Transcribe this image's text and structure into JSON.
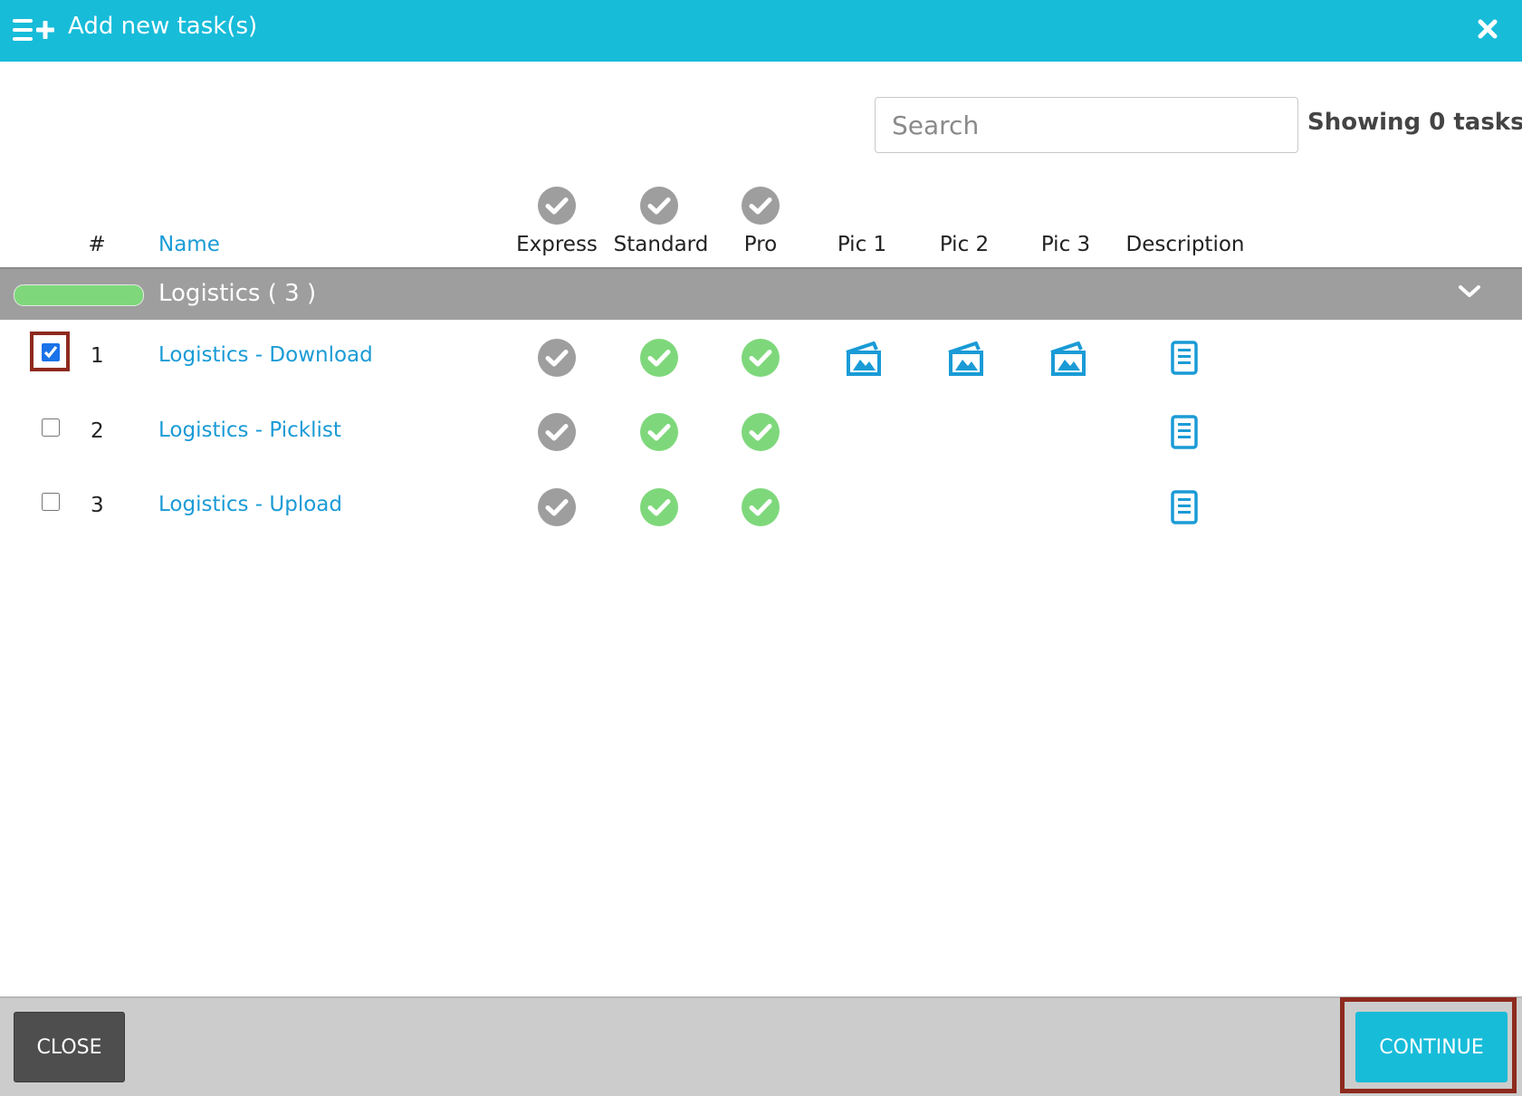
{
  "dialog": {
    "title": "Add new task(s)",
    "close_icon": "close-icon",
    "title_icon": "list-add-icon"
  },
  "search": {
    "placeholder": "Search",
    "value": ""
  },
  "status": {
    "showing": "Showing 0 tasks"
  },
  "columns": {
    "num": "#",
    "name": "Name",
    "express": "Express",
    "standard": "Standard",
    "pro": "Pro",
    "pic1": "Pic 1",
    "pic2": "Pic 2",
    "pic3": "Pic 3",
    "description": "Description"
  },
  "group": {
    "label": "Logistics ( 3 )",
    "color": "#7ed87b"
  },
  "rows": [
    {
      "num": "1",
      "name": "Logistics - Download",
      "checked": true,
      "express": false,
      "standard": true,
      "pro": true,
      "pics": [
        true,
        true,
        true
      ],
      "description": true
    },
    {
      "num": "2",
      "name": "Logistics - Picklist",
      "checked": false,
      "express": false,
      "standard": true,
      "pro": true,
      "pics": [
        false,
        false,
        false
      ],
      "description": true
    },
    {
      "num": "3",
      "name": "Logistics - Upload",
      "checked": false,
      "express": false,
      "standard": true,
      "pro": true,
      "pics": [
        false,
        false,
        false
      ],
      "description": true
    }
  ],
  "footer": {
    "close_label": "CLOSE",
    "continue_label": "CONTINUE"
  },
  "colors": {
    "accent": "#17bcd9",
    "link": "#1a9bd6",
    "enabled": "#7ed87b",
    "disabled": "#9e9e9e",
    "highlight": "#8e2a1e"
  }
}
